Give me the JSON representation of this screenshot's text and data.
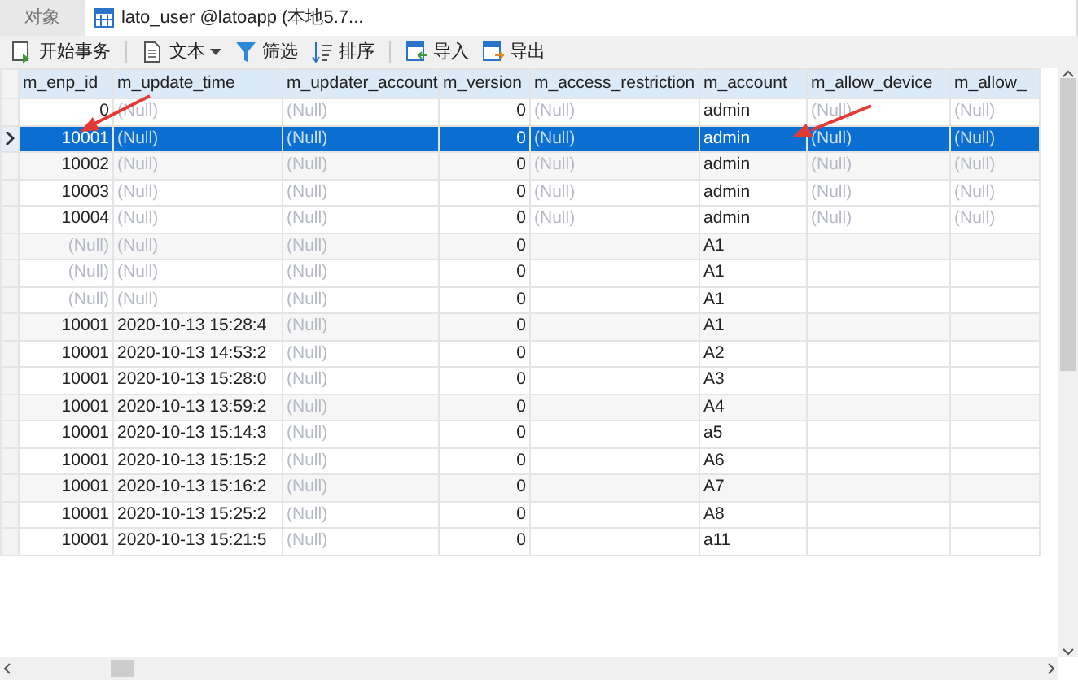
{
  "tabs": [
    {
      "label": "对象",
      "selected": false,
      "kind": "plain"
    },
    {
      "label": "lato_user @latoapp (本地5.7...",
      "selected": true,
      "kind": "table"
    }
  ],
  "toolbar": [
    {
      "label": "开始事务",
      "kind": "transaction",
      "dropdown": false
    },
    {
      "label": "文本",
      "kind": "text",
      "dropdown": true
    },
    {
      "label": "筛选",
      "kind": "filter",
      "dropdown": false
    },
    {
      "label": "排序",
      "kind": "sort",
      "dropdown": false
    },
    {
      "label": "导入",
      "kind": "import",
      "dropdown": false
    },
    {
      "label": "导出",
      "kind": "export",
      "dropdown": false
    }
  ],
  "table": {
    "columns": [
      {
        "label": "m_enp_id",
        "kind": "number"
      },
      {
        "label": "m_update_time",
        "kind": "text"
      },
      {
        "label": "m_updater_account",
        "kind": "text"
      },
      {
        "label": "m_version",
        "kind": "number"
      },
      {
        "label": "m_access_restriction",
        "kind": "text"
      },
      {
        "label": "m_account",
        "kind": "text"
      },
      {
        "label": "m_allow_device",
        "kind": "text"
      },
      {
        "label": "m_allow_",
        "kind": "text"
      }
    ],
    "rows": [
      {
        "selected": false,
        "cells": [
          {
            "text": "0",
            "kind": "value"
          },
          {
            "text": "(Null)",
            "kind": "null"
          },
          {
            "text": "(Null)",
            "kind": "null"
          },
          {
            "text": "0",
            "kind": "value"
          },
          {
            "text": "(Null)",
            "kind": "null"
          },
          {
            "text": "admin",
            "kind": "value"
          },
          {
            "text": "(Null)",
            "kind": "null"
          },
          {
            "text": "(Null)",
            "kind": "null"
          }
        ]
      },
      {
        "selected": true,
        "cells": [
          {
            "text": "10001",
            "kind": "value"
          },
          {
            "text": "(Null)",
            "kind": "null"
          },
          {
            "text": "(Null)",
            "kind": "null"
          },
          {
            "text": "0",
            "kind": "value"
          },
          {
            "text": "(Null)",
            "kind": "null"
          },
          {
            "text": "admin",
            "kind": "value"
          },
          {
            "text": "(Null)",
            "kind": "null"
          },
          {
            "text": "(Null)",
            "kind": "null"
          }
        ]
      },
      {
        "selected": false,
        "cells": [
          {
            "text": "10002",
            "kind": "value"
          },
          {
            "text": "(Null)",
            "kind": "null"
          },
          {
            "text": "(Null)",
            "kind": "null"
          },
          {
            "text": "0",
            "kind": "value"
          },
          {
            "text": "(Null)",
            "kind": "null"
          },
          {
            "text": "admin",
            "kind": "value"
          },
          {
            "text": "(Null)",
            "kind": "null"
          },
          {
            "text": "(Null)",
            "kind": "null"
          }
        ]
      },
      {
        "selected": false,
        "cells": [
          {
            "text": "10003",
            "kind": "value"
          },
          {
            "text": "(Null)",
            "kind": "null"
          },
          {
            "text": "(Null)",
            "kind": "null"
          },
          {
            "text": "0",
            "kind": "value"
          },
          {
            "text": "(Null)",
            "kind": "null"
          },
          {
            "text": "admin",
            "kind": "value"
          },
          {
            "text": "(Null)",
            "kind": "null"
          },
          {
            "text": "(Null)",
            "kind": "null"
          }
        ]
      },
      {
        "selected": false,
        "cells": [
          {
            "text": "10004",
            "kind": "value"
          },
          {
            "text": "(Null)",
            "kind": "null"
          },
          {
            "text": "(Null)",
            "kind": "null"
          },
          {
            "text": "0",
            "kind": "value"
          },
          {
            "text": "(Null)",
            "kind": "null"
          },
          {
            "text": "admin",
            "kind": "value"
          },
          {
            "text": "(Null)",
            "kind": "null"
          },
          {
            "text": "(Null)",
            "kind": "null"
          }
        ]
      },
      {
        "selected": false,
        "cells": [
          {
            "text": "(Null)",
            "kind": "null"
          },
          {
            "text": "(Null)",
            "kind": "null"
          },
          {
            "text": "(Null)",
            "kind": "null"
          },
          {
            "text": "0",
            "kind": "value"
          },
          null,
          {
            "text": "A1",
            "kind": "value"
          },
          null,
          null
        ]
      },
      {
        "selected": false,
        "cells": [
          {
            "text": "(Null)",
            "kind": "null"
          },
          {
            "text": "(Null)",
            "kind": "null"
          },
          {
            "text": "(Null)",
            "kind": "null"
          },
          {
            "text": "0",
            "kind": "value"
          },
          null,
          {
            "text": "A1",
            "kind": "value"
          },
          null,
          null
        ]
      },
      {
        "selected": false,
        "cells": [
          {
            "text": "(Null)",
            "kind": "null"
          },
          {
            "text": "(Null)",
            "kind": "null"
          },
          {
            "text": "(Null)",
            "kind": "null"
          },
          {
            "text": "0",
            "kind": "value"
          },
          null,
          {
            "text": "A1",
            "kind": "value"
          },
          null,
          null
        ]
      },
      {
        "selected": false,
        "cells": [
          {
            "text": "10001",
            "kind": "value"
          },
          {
            "text": "2020-10-13 15:28:4",
            "kind": "value"
          },
          {
            "text": "(Null)",
            "kind": "null"
          },
          {
            "text": "0",
            "kind": "value"
          },
          null,
          {
            "text": "A1",
            "kind": "value"
          },
          null,
          null
        ]
      },
      {
        "selected": false,
        "cells": [
          {
            "text": "10001",
            "kind": "value"
          },
          {
            "text": "2020-10-13 14:53:2",
            "kind": "value"
          },
          {
            "text": "(Null)",
            "kind": "null"
          },
          {
            "text": "0",
            "kind": "value"
          },
          null,
          {
            "text": "A2",
            "kind": "value"
          },
          null,
          null
        ]
      },
      {
        "selected": false,
        "cells": [
          {
            "text": "10001",
            "kind": "value"
          },
          {
            "text": "2020-10-13 15:28:0",
            "kind": "value"
          },
          {
            "text": "(Null)",
            "kind": "null"
          },
          {
            "text": "0",
            "kind": "value"
          },
          null,
          {
            "text": "A3",
            "kind": "value"
          },
          null,
          null
        ]
      },
      {
        "selected": false,
        "cells": [
          {
            "text": "10001",
            "kind": "value"
          },
          {
            "text": "2020-10-13 13:59:2",
            "kind": "value"
          },
          {
            "text": "(Null)",
            "kind": "null"
          },
          {
            "text": "0",
            "kind": "value"
          },
          null,
          {
            "text": "A4",
            "kind": "value"
          },
          null,
          null
        ]
      },
      {
        "selected": false,
        "cells": [
          {
            "text": "10001",
            "kind": "value"
          },
          {
            "text": "2020-10-13 15:14:3",
            "kind": "value"
          },
          {
            "text": "(Null)",
            "kind": "null"
          },
          {
            "text": "0",
            "kind": "value"
          },
          null,
          {
            "text": "a5",
            "kind": "value"
          },
          null,
          null
        ]
      },
      {
        "selected": false,
        "cells": [
          {
            "text": "10001",
            "kind": "value"
          },
          {
            "text": "2020-10-13 15:15:2",
            "kind": "value"
          },
          {
            "text": "(Null)",
            "kind": "null"
          },
          {
            "text": "0",
            "kind": "value"
          },
          null,
          {
            "text": "A6",
            "kind": "value"
          },
          null,
          null
        ]
      },
      {
        "selected": false,
        "cells": [
          {
            "text": "10001",
            "kind": "value"
          },
          {
            "text": "2020-10-13 15:16:2",
            "kind": "value"
          },
          {
            "text": "(Null)",
            "kind": "null"
          },
          {
            "text": "0",
            "kind": "value"
          },
          null,
          {
            "text": "A7",
            "kind": "value"
          },
          null,
          null
        ]
      },
      {
        "selected": false,
        "cells": [
          {
            "text": "10001",
            "kind": "value"
          },
          {
            "text": "2020-10-13 15:25:2",
            "kind": "value"
          },
          {
            "text": "(Null)",
            "kind": "null"
          },
          {
            "text": "0",
            "kind": "value"
          },
          null,
          {
            "text": "A8",
            "kind": "value"
          },
          null,
          null
        ]
      },
      {
        "selected": false,
        "cells": [
          {
            "text": "10001",
            "kind": "value"
          },
          {
            "text": "2020-10-13 15:21:5",
            "kind": "value"
          },
          {
            "text": "(Null)",
            "kind": "null"
          },
          {
            "text": "0",
            "kind": "value"
          },
          null,
          {
            "text": "a11",
            "kind": "value"
          },
          null,
          null
        ]
      }
    ]
  }
}
